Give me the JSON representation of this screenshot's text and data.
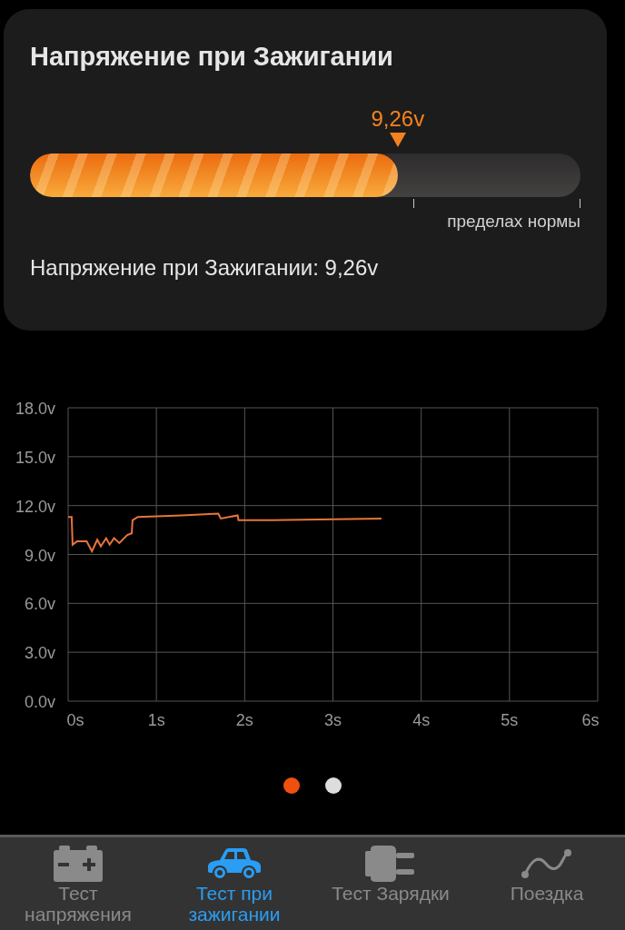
{
  "card": {
    "title": "Напряжение при Зажигании",
    "gauge": {
      "level": 0.668,
      "marker_label": "9,26v",
      "range_label": "пределах нормы"
    },
    "reading": "Напряжение при Зажигании: 9,26v"
  },
  "chart": {
    "chart_data": {
      "type": "line",
      "x": [
        0,
        0.04,
        0.05,
        0.1,
        0.21,
        0.27,
        0.33,
        0.37,
        0.43,
        0.47,
        0.52,
        0.58,
        0.67,
        0.72,
        0.73,
        0.79,
        1.29,
        1.7,
        1.73,
        1.92,
        1.93,
        2.31,
        2.83,
        3.55
      ],
      "grid": true,
      "series": [
        {
          "color": "#e8743b",
          "values": [
            11.3,
            11.3,
            9.6,
            9.8,
            9.8,
            9.2,
            9.9,
            9.5,
            10.0,
            9.6,
            10.0,
            9.7,
            10.2,
            10.3,
            11.1,
            11.3,
            11.4,
            11.5,
            11.2,
            11.4,
            11.1,
            11.1,
            11.15,
            11.2
          ]
        }
      ],
      "xlim": [
        0,
        6
      ],
      "ylim": [
        0,
        18
      ],
      "xticks": [
        {
          "value": 0,
          "label": "0s"
        },
        {
          "value": 1,
          "label": "1s"
        },
        {
          "value": 2,
          "label": "2s"
        },
        {
          "value": 3,
          "label": "3s"
        },
        {
          "value": 4,
          "label": "4s"
        },
        {
          "value": 5,
          "label": "5s"
        },
        {
          "value": 6,
          "label": "6s"
        }
      ],
      "yticks": [
        {
          "value": 0,
          "label": "0.0v"
        },
        {
          "value": 3,
          "label": "3.0v"
        },
        {
          "value": 6,
          "label": "6.0v"
        },
        {
          "value": 9,
          "label": "9.0v"
        },
        {
          "value": 12,
          "label": "12.0v"
        },
        {
          "value": 15,
          "label": "15.0v"
        },
        {
          "value": 18,
          "label": "18.0v"
        }
      ]
    }
  },
  "pager": [
    {
      "selected": true
    },
    {
      "selected": false
    }
  ],
  "nav": [
    {
      "kind": "battery",
      "label": "Тест напряжения",
      "selected": false
    },
    {
      "kind": "car",
      "label": "Тест при зажигании",
      "selected": true
    },
    {
      "kind": "plug",
      "label": "Тест Зарядки",
      "selected": false
    },
    {
      "kind": "trip",
      "label": "Поездка",
      "selected": false
    }
  ]
}
